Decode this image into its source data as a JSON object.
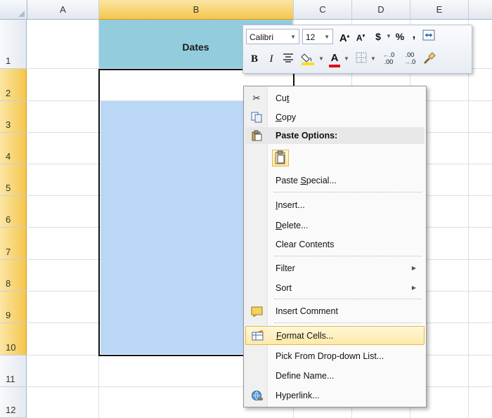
{
  "columns": [
    "A",
    "B",
    "C",
    "D",
    "E"
  ],
  "rows": [
    "1",
    "2",
    "3",
    "4",
    "5",
    "6",
    "7",
    "8",
    "9",
    "10",
    "11",
    "12"
  ],
  "cells": {
    "B1": "Dates"
  },
  "mini_toolbar": {
    "font_name": "Calibri",
    "font_size": "12",
    "grow_font": "A",
    "shrink_font": "A",
    "currency": "$",
    "percent": "%",
    "comma": ",",
    "bold": "B",
    "italic": "I",
    "font_color": "A"
  },
  "context_menu": {
    "items": [
      {
        "icon": "scissors-icon",
        "label": "Cut",
        "accel": "t"
      },
      {
        "icon": "copy-icon",
        "label": "Copy",
        "accel": "C"
      },
      {
        "icon": "paste-icon",
        "label": "Paste Options:",
        "header": true
      },
      {
        "icon": "clipboard-icon",
        "label": ""
      },
      {
        "label": "Paste Special...",
        "accel": "S"
      },
      {
        "label": "Insert...",
        "accel": "I"
      },
      {
        "label": "Delete...",
        "accel": "D"
      },
      {
        "label": "Clear Contents",
        "accel": "N"
      },
      {
        "label": "Filter",
        "accel": "E",
        "submenu": true
      },
      {
        "label": "Sort",
        "accel": "O",
        "submenu": true
      },
      {
        "icon": "comment-icon",
        "label": "Insert Comment",
        "accel": "M"
      },
      {
        "icon": "format-cells-icon",
        "label": "Format Cells...",
        "accel": "F",
        "highlighted": true
      },
      {
        "label": "Pick From Drop-down List...",
        "accel": "K"
      },
      {
        "label": "Define Name...",
        "accel": "A"
      },
      {
        "icon": "hyperlink-icon",
        "label": "Hyperlink...",
        "accel": "I"
      }
    ]
  },
  "colors": {
    "header_fill": "#93cddd",
    "selection_fill": "#bad8f6",
    "selected_header": "#f5c64d",
    "menu_highlight": "#fde9a8"
  }
}
